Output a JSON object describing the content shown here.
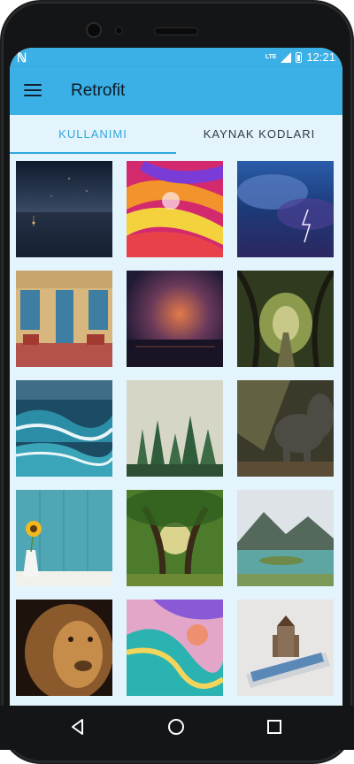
{
  "status_bar": {
    "time": "12:21",
    "network": "LTE",
    "notification_icon": "n-icon"
  },
  "app_bar": {
    "title": "Retrofit",
    "menu_icon": "hamburger-icon"
  },
  "tabs": [
    {
      "label": "KULLANIMI",
      "selected": true
    },
    {
      "label": "KAYNAK KODLARI",
      "selected": false
    }
  ],
  "grid": {
    "images": [
      "night-sky-boat",
      "colorful-paint-swirl",
      "storm-clouds-lightning",
      "cafe-building-street",
      "sunset-storm-over-sea",
      "tree-tunnel-road",
      "ocean-waves",
      "misty-pine-forest",
      "elephant-in-light",
      "sunflower-vase-wood",
      "sunlit-oak-tree",
      "mountain-lake",
      "lion-portrait",
      "fluid-colorful-art",
      "castle-on-phone"
    ]
  },
  "nav_bar": {
    "back_icon": "back-icon",
    "home_icon": "home-icon",
    "recents_icon": "recents-icon"
  },
  "colors": {
    "accent": "#3bb0e6",
    "tab_active": "#2fa8dc",
    "background": "#e4f4fd"
  }
}
